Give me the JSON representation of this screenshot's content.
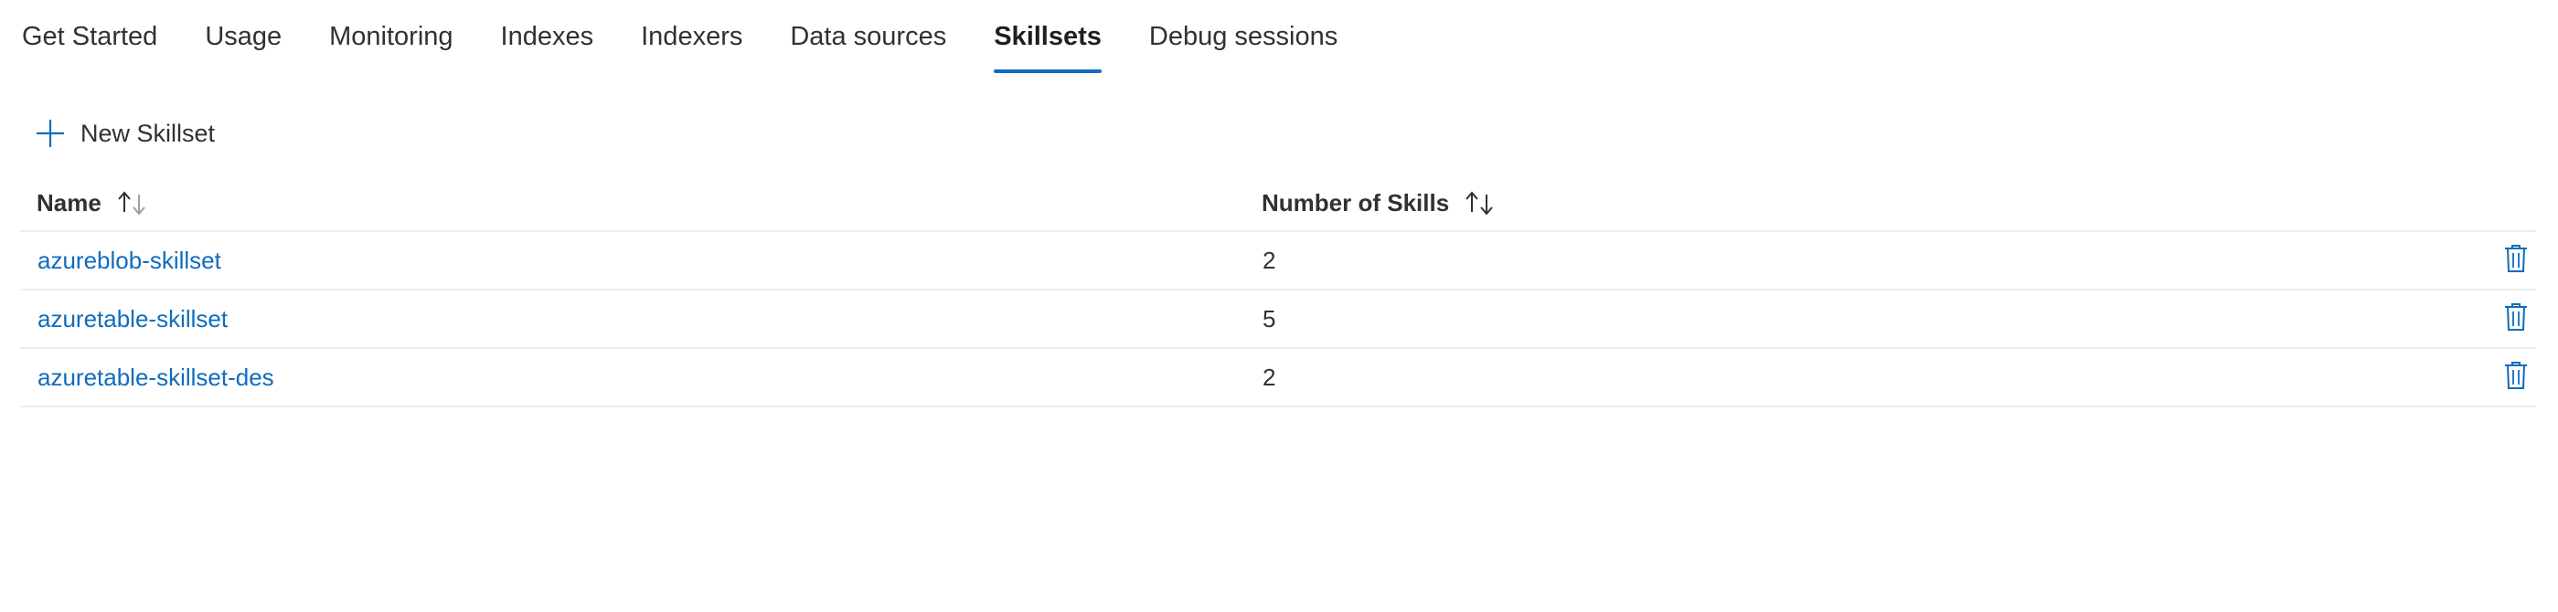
{
  "tabs": [
    {
      "label": "Get Started",
      "active": false
    },
    {
      "label": "Usage",
      "active": false
    },
    {
      "label": "Monitoring",
      "active": false
    },
    {
      "label": "Indexes",
      "active": false
    },
    {
      "label": "Indexers",
      "active": false
    },
    {
      "label": "Data sources",
      "active": false
    },
    {
      "label": "Skillsets",
      "active": true
    },
    {
      "label": "Debug sessions",
      "active": false
    }
  ],
  "toolbar": {
    "new_label": "New Skillset",
    "new_icon": "plus-icon"
  },
  "table": {
    "columns": [
      "Name",
      "Number of Skills"
    ],
    "rows": [
      {
        "name": "azureblob-skillset",
        "skills": "2"
      },
      {
        "name": "azuretable-skillset",
        "skills": "5"
      },
      {
        "name": "azuretable-skillset-des",
        "skills": "2"
      }
    ],
    "row_action_icon": "trash-icon"
  },
  "colors": {
    "accent": "#0f6cbd",
    "text": "#323130",
    "divider": "#edebe9"
  }
}
